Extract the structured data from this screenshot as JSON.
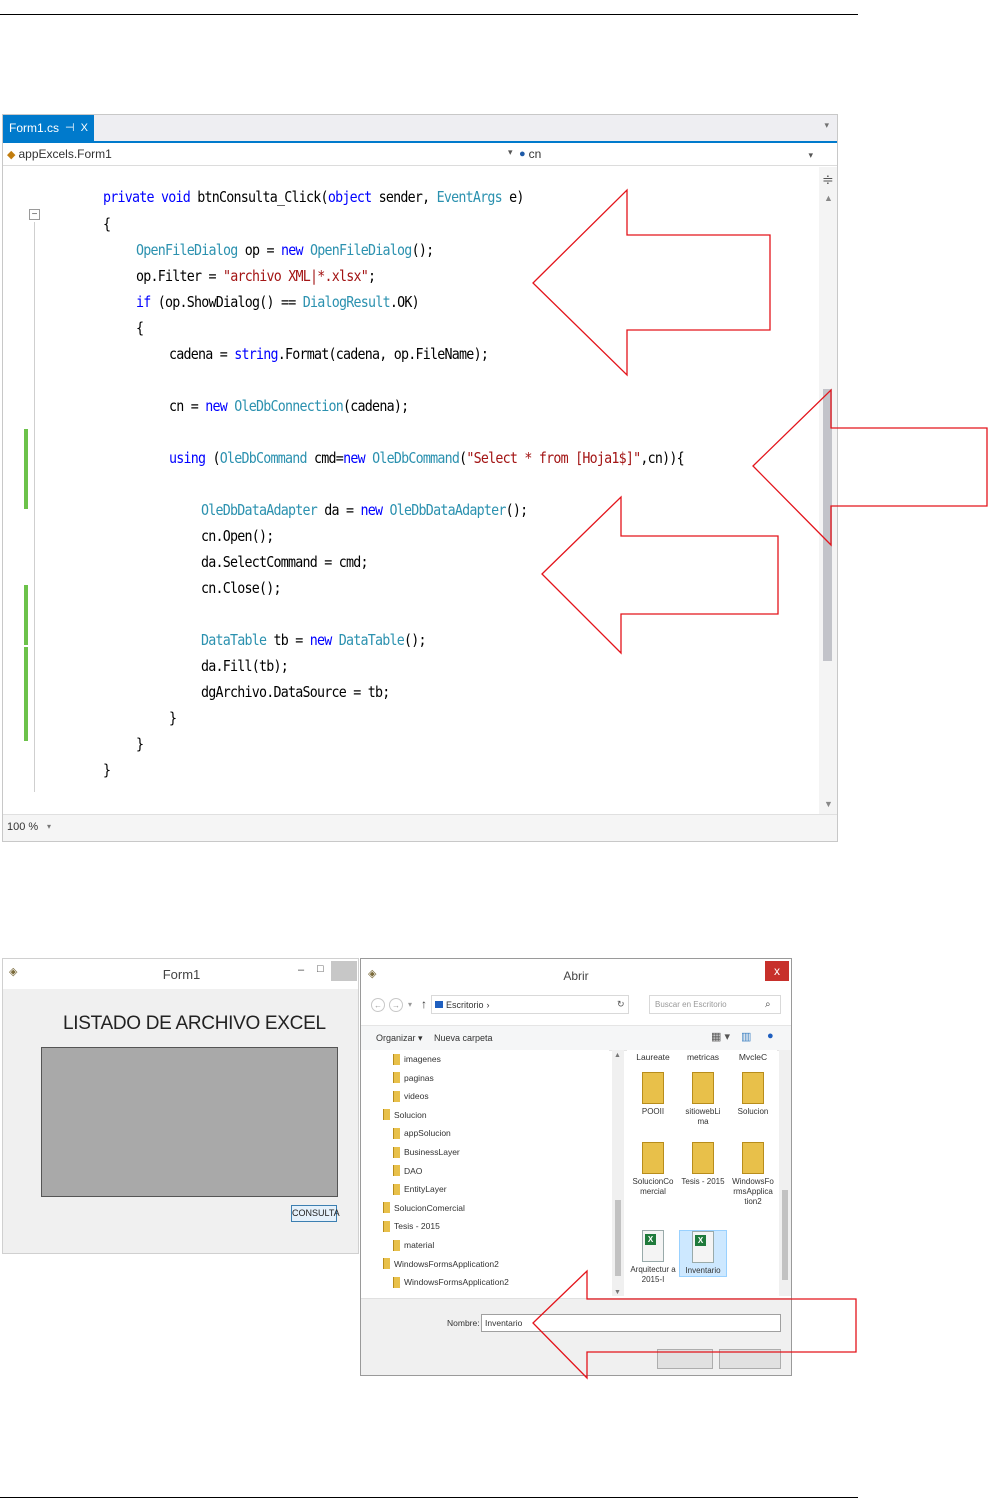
{
  "editor": {
    "tab_label": "Form1.cs",
    "tab_pin": "⊣",
    "tab_close": "X",
    "nav_class": "appExcels.Form1",
    "nav_member": "cn",
    "zoom": "100 %",
    "code": [
      {
        "tokens": [
          {
            "t": "private",
            "k": "kw"
          },
          {
            "t": " "
          },
          {
            "t": "void",
            "k": "kw"
          },
          {
            "t": " btnConsulta_Click("
          },
          {
            "t": "object",
            "k": "kw"
          },
          {
            "t": " sender, "
          },
          {
            "t": "EventArgs",
            "k": "ty"
          },
          {
            "t": " e)"
          }
        ]
      },
      {
        "tokens": [
          {
            "t": "{"
          }
        ]
      },
      {
        "tokens": [
          {
            "t": "OpenFileDialog",
            "k": "ty"
          },
          {
            "t": " op = "
          },
          {
            "t": "new",
            "k": "kw"
          },
          {
            "t": " "
          },
          {
            "t": "OpenFileDialog",
            "k": "ty"
          },
          {
            "t": "();"
          }
        ]
      },
      {
        "tokens": [
          {
            "t": "op.Filter = "
          },
          {
            "t": "\"archivo XML|*.xlsx\"",
            "k": "st"
          },
          {
            "t": ";"
          }
        ]
      },
      {
        "tokens": [
          {
            "t": "if",
            "k": "kw"
          },
          {
            "t": " (op.ShowDialog() == "
          },
          {
            "t": "DialogResult",
            "k": "ty"
          },
          {
            "t": ".OK)"
          }
        ]
      },
      {
        "tokens": [
          {
            "t": "{"
          }
        ]
      },
      {
        "tokens": [
          {
            "t": "cadena = "
          },
          {
            "t": "string",
            "k": "kw"
          },
          {
            "t": ".Format(cadena, op.FileName);"
          }
        ]
      },
      {
        "tokens": []
      },
      {
        "tokens": [
          {
            "t": "cn = "
          },
          {
            "t": "new",
            "k": "kw"
          },
          {
            "t": " "
          },
          {
            "t": "OleDbConnection",
            "k": "ty"
          },
          {
            "t": "(cadena);"
          }
        ]
      },
      {
        "tokens": []
      },
      {
        "tokens": [
          {
            "t": "using",
            "k": "kw"
          },
          {
            "t": " ("
          },
          {
            "t": "OleDbCommand",
            "k": "ty"
          },
          {
            "t": " cmd="
          },
          {
            "t": "new",
            "k": "kw"
          },
          {
            "t": " "
          },
          {
            "t": "OleDbCommand",
            "k": "ty"
          },
          {
            "t": "("
          },
          {
            "t": "\"Select * from [Hoja1$]\"",
            "k": "st"
          },
          {
            "t": ",cn)){"
          }
        ]
      },
      {
        "tokens": []
      },
      {
        "tokens": [
          {
            "t": "OleDbDataAdapter",
            "k": "ty"
          },
          {
            "t": " da = "
          },
          {
            "t": "new",
            "k": "kw"
          },
          {
            "t": " "
          },
          {
            "t": "OleDbDataAdapter",
            "k": "ty"
          },
          {
            "t": "();"
          }
        ]
      },
      {
        "tokens": [
          {
            "t": "cn.Open();"
          }
        ]
      },
      {
        "tokens": [
          {
            "t": "da.SelectCommand = cmd;"
          }
        ]
      },
      {
        "tokens": [
          {
            "t": "cn.Close();"
          }
        ]
      },
      {
        "tokens": []
      },
      {
        "tokens": [
          {
            "t": "DataTable",
            "k": "ty"
          },
          {
            "t": " tb = "
          },
          {
            "t": "new",
            "k": "kw"
          },
          {
            "t": " "
          },
          {
            "t": "DataTable",
            "k": "ty"
          },
          {
            "t": "();"
          }
        ]
      },
      {
        "tokens": [
          {
            "t": "da.Fill(tb);"
          }
        ]
      },
      {
        "tokens": [
          {
            "t": "dgArchivo.DataSource = tb;"
          }
        ]
      },
      {
        "tokens": [
          {
            "t": "}"
          }
        ]
      },
      {
        "tokens": [
          {
            "t": "}"
          }
        ]
      },
      {
        "tokens": [
          {
            "t": "}"
          }
        ]
      }
    ]
  },
  "form1": {
    "title": "Form1",
    "heading": "LISTADO DE ARCHIVO EXCEL",
    "button_label": "CONSULTA"
  },
  "abrir": {
    "title": "Abrir",
    "close": "x",
    "address": "Escritorio",
    "address_sep": "›",
    "search_placeholder": "Buscar en Escritorio",
    "organizar": "Organizar ▾",
    "nueva_carpeta": "Nueva carpeta",
    "tree": [
      {
        "label": "imagenes"
      },
      {
        "label": "paginas"
      },
      {
        "label": "videos"
      },
      {
        "label": "Solucion"
      },
      {
        "label": "appSolucion"
      },
      {
        "label": "BusinessLayer"
      },
      {
        "label": "DAO"
      },
      {
        "label": "EntityLayer"
      },
      {
        "label": "SolucionComercial"
      },
      {
        "label": "Tesis - 2015"
      },
      {
        "label": "material"
      },
      {
        "label": "WindowsFormsApplication2"
      },
      {
        "label": "WindowsFormsApplication2"
      }
    ],
    "top_names": [
      "Laureate",
      "metricas",
      "MvcleC"
    ],
    "files": [
      {
        "label": "POOII",
        "kind": "folder"
      },
      {
        "label": "sitiowebLi ma",
        "kind": "folder"
      },
      {
        "label": "Solucion",
        "kind": "folder"
      },
      {
        "label": "SolucionCo mercial",
        "kind": "folder"
      },
      {
        "label": "Tesis - 2015",
        "kind": "folder"
      },
      {
        "label": "WindowsFo rmsApplica tion2",
        "kind": "folder"
      },
      {
        "label": "Arquitectur a 2015-I",
        "kind": "xls"
      },
      {
        "label": "Inventario",
        "kind": "xls",
        "selected": true
      }
    ],
    "nombre_label": "Nombre:",
    "nombre_value": "Inventario"
  }
}
